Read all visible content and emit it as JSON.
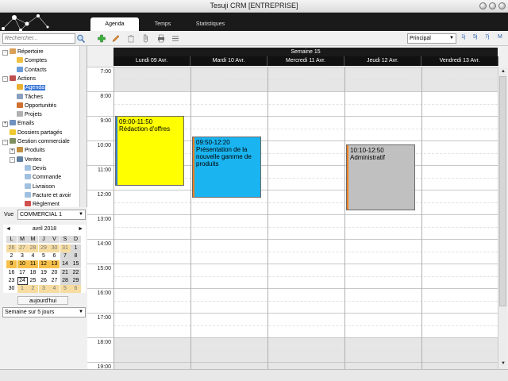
{
  "window": {
    "title": "Tesuji CRM [ENTREPRISE]"
  },
  "tabs": [
    {
      "label": "Agenda",
      "active": true
    },
    {
      "label": "Temps",
      "active": false
    },
    {
      "label": "Statistiques",
      "active": false
    }
  ],
  "toolbar": {
    "search_placeholder": "Rechercher...",
    "calendar_select": "Principal",
    "view_buttons": [
      "1j",
      "5j",
      "7j",
      "M"
    ]
  },
  "tree": [
    {
      "label": "Répertoire",
      "level": 0,
      "icon": "address-book-icon",
      "expander": "-"
    },
    {
      "label": "Comptes",
      "level": 1,
      "icon": "accounts-icon"
    },
    {
      "label": "Contacts",
      "level": 1,
      "icon": "contacts-icon"
    },
    {
      "label": "Actions",
      "level": 0,
      "icon": "actions-icon",
      "expander": "-"
    },
    {
      "label": "Agenda",
      "level": 1,
      "icon": "calendar-icon",
      "selected": true
    },
    {
      "label": "Tâches",
      "level": 1,
      "icon": "tasks-icon"
    },
    {
      "label": "Opportunités",
      "level": 1,
      "icon": "opportunities-icon"
    },
    {
      "label": "Projets",
      "level": 1,
      "icon": "projects-icon"
    },
    {
      "label": "Emails",
      "level": 0,
      "icon": "email-icon",
      "expander": "+"
    },
    {
      "label": "Dossiers partagés",
      "level": 0,
      "icon": "shared-folder-icon"
    },
    {
      "label": "Gestion commerciale",
      "level": 0,
      "icon": "commerce-icon",
      "expander": "-"
    },
    {
      "label": "Produits",
      "level": 1,
      "icon": "products-icon",
      "expander": "+"
    },
    {
      "label": "Ventes",
      "level": 1,
      "icon": "sales-icon",
      "expander": "-"
    },
    {
      "label": "Devis",
      "level": 2,
      "icon": "quote-icon"
    },
    {
      "label": "Commande",
      "level": 2,
      "icon": "order-icon"
    },
    {
      "label": "Livraison",
      "level": 2,
      "icon": "delivery-icon"
    },
    {
      "label": "Facture et avoir",
      "level": 2,
      "icon": "invoice-icon"
    },
    {
      "label": "Règlement",
      "level": 2,
      "icon": "payment-icon"
    }
  ],
  "vue": {
    "label": "Vue",
    "value": "COMMERCIAL 1"
  },
  "mini_calendar": {
    "month": "avril 2018",
    "prev": "◄",
    "next": "►",
    "dow": [
      "L",
      "M",
      "M",
      "J",
      "V",
      "S",
      "D"
    ],
    "weeks": [
      [
        "26",
        "27",
        "28",
        "29",
        "30",
        "31",
        "1"
      ],
      [
        "2",
        "3",
        "4",
        "5",
        "6",
        "7",
        "8"
      ],
      [
        "9",
        "10",
        "11",
        "12",
        "13",
        "14",
        "15"
      ],
      [
        "16",
        "17",
        "18",
        "19",
        "20",
        "21",
        "22"
      ],
      [
        "23",
        "24",
        "25",
        "26",
        "27",
        "28",
        "29"
      ],
      [
        "30",
        "1",
        "2",
        "3",
        "4",
        "5",
        "6"
      ]
    ],
    "today_button": "aujourd'hui",
    "mode": "Semaine sur 5 jours"
  },
  "agenda": {
    "week_label": "Semaine 15",
    "days": [
      "Lundi 09 Avr.",
      "Mardi 10 Avr.",
      "Mercredi 11 Avr.",
      "Jeudi 12 Avr.",
      "Vendredi 13 Avr."
    ],
    "hours": [
      "7:00",
      "8:00",
      "9:00",
      "10:00",
      "11:00",
      "12:00",
      "13:00",
      "14:00",
      "15:00",
      "16:00",
      "17:00",
      "18:00",
      "19:00"
    ],
    "events": [
      {
        "day": 0,
        "start": 9.0,
        "end": 11.833,
        "time": "09:00-11:50",
        "title": "Rédaction d'offres",
        "color": "#ffff00",
        "stripe": "#2f7fd0"
      },
      {
        "day": 1,
        "start": 9.833,
        "end": 12.333,
        "time": "09:50-12:20",
        "title": "Présentation de la nouvelle gamme de produits",
        "color": "#1ab4f0",
        "stripe": "#f08020"
      },
      {
        "day": 3,
        "start": 10.167,
        "end": 12.833,
        "time": "10:10-12:50",
        "title": "Administratif",
        "color": "#c0c0c0",
        "stripe": "#f08020"
      }
    ]
  },
  "colors": {
    "header_bg": "#1a1a1a",
    "selection": "#3875d7",
    "today_highlight": "#f6c04a"
  }
}
